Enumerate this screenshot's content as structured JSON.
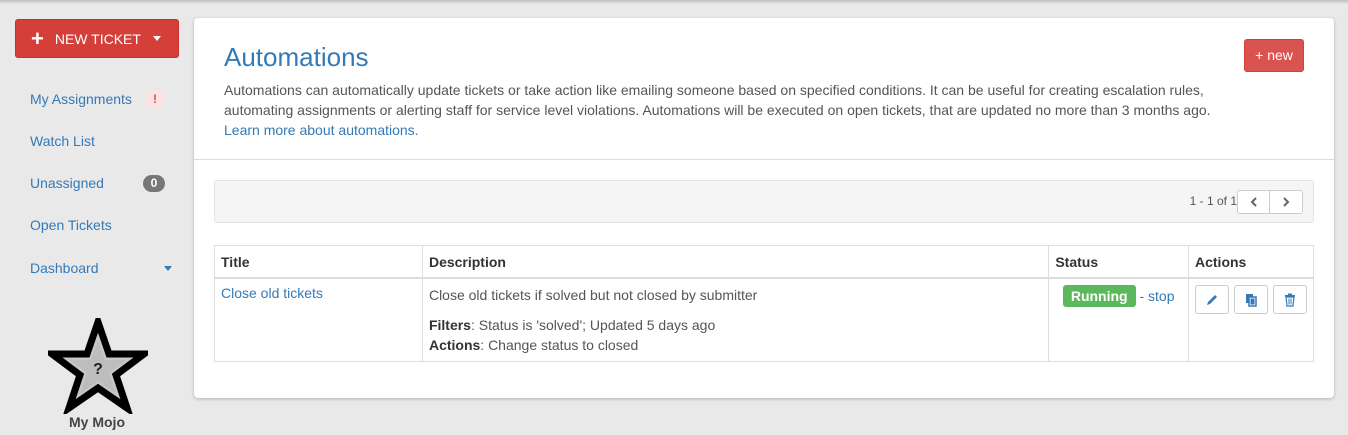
{
  "sidebar": {
    "new_ticket_label": "NEW TICKET",
    "items": [
      {
        "label": "My Assignments",
        "badge": "!"
      },
      {
        "label": "Watch List"
      },
      {
        "label": "Unassigned",
        "badge": "0"
      },
      {
        "label": "Open Tickets"
      },
      {
        "label": "Dashboard"
      }
    ],
    "mojo_label": "My Mojo",
    "mojo_icon": "star-icon",
    "mojo_mark": "?"
  },
  "main": {
    "title": "Automations",
    "new_button_label": "+ new",
    "description": "Automations can automatically update tickets or take action like emailing someone based on specified conditions. It can be useful for creating escalation rules, automating assignments or alerting staff for service level violations. Automations will be executed on open tickets, that are updated no more than 3 months ago.",
    "learn_more_label": "Learn more about automations.",
    "pagination": {
      "text": "1 - 1 of 1",
      "prev_icon": "chevron-left-icon",
      "next_icon": "chevron-right-icon"
    },
    "table": {
      "headers": [
        "Title",
        "Description",
        "Status",
        "Actions"
      ],
      "rows": [
        {
          "title": "Close old tickets",
          "description": "Close old tickets if solved but not closed by submitter",
          "filters_label": "Filters",
          "filters_value": ": Status is 'solved'; Updated 5 days ago",
          "actions_label": "Actions",
          "actions_value": ": Change status to closed",
          "status": "Running",
          "stop_label": "- stop",
          "action_icons": [
            "pencil-icon",
            "copy-icon",
            "trash-icon"
          ]
        }
      ]
    }
  },
  "colors": {
    "brand_red": "#d43f3a",
    "link_blue": "#337ab7",
    "running_green": "#5cb85c",
    "badge_gray": "#777777"
  }
}
